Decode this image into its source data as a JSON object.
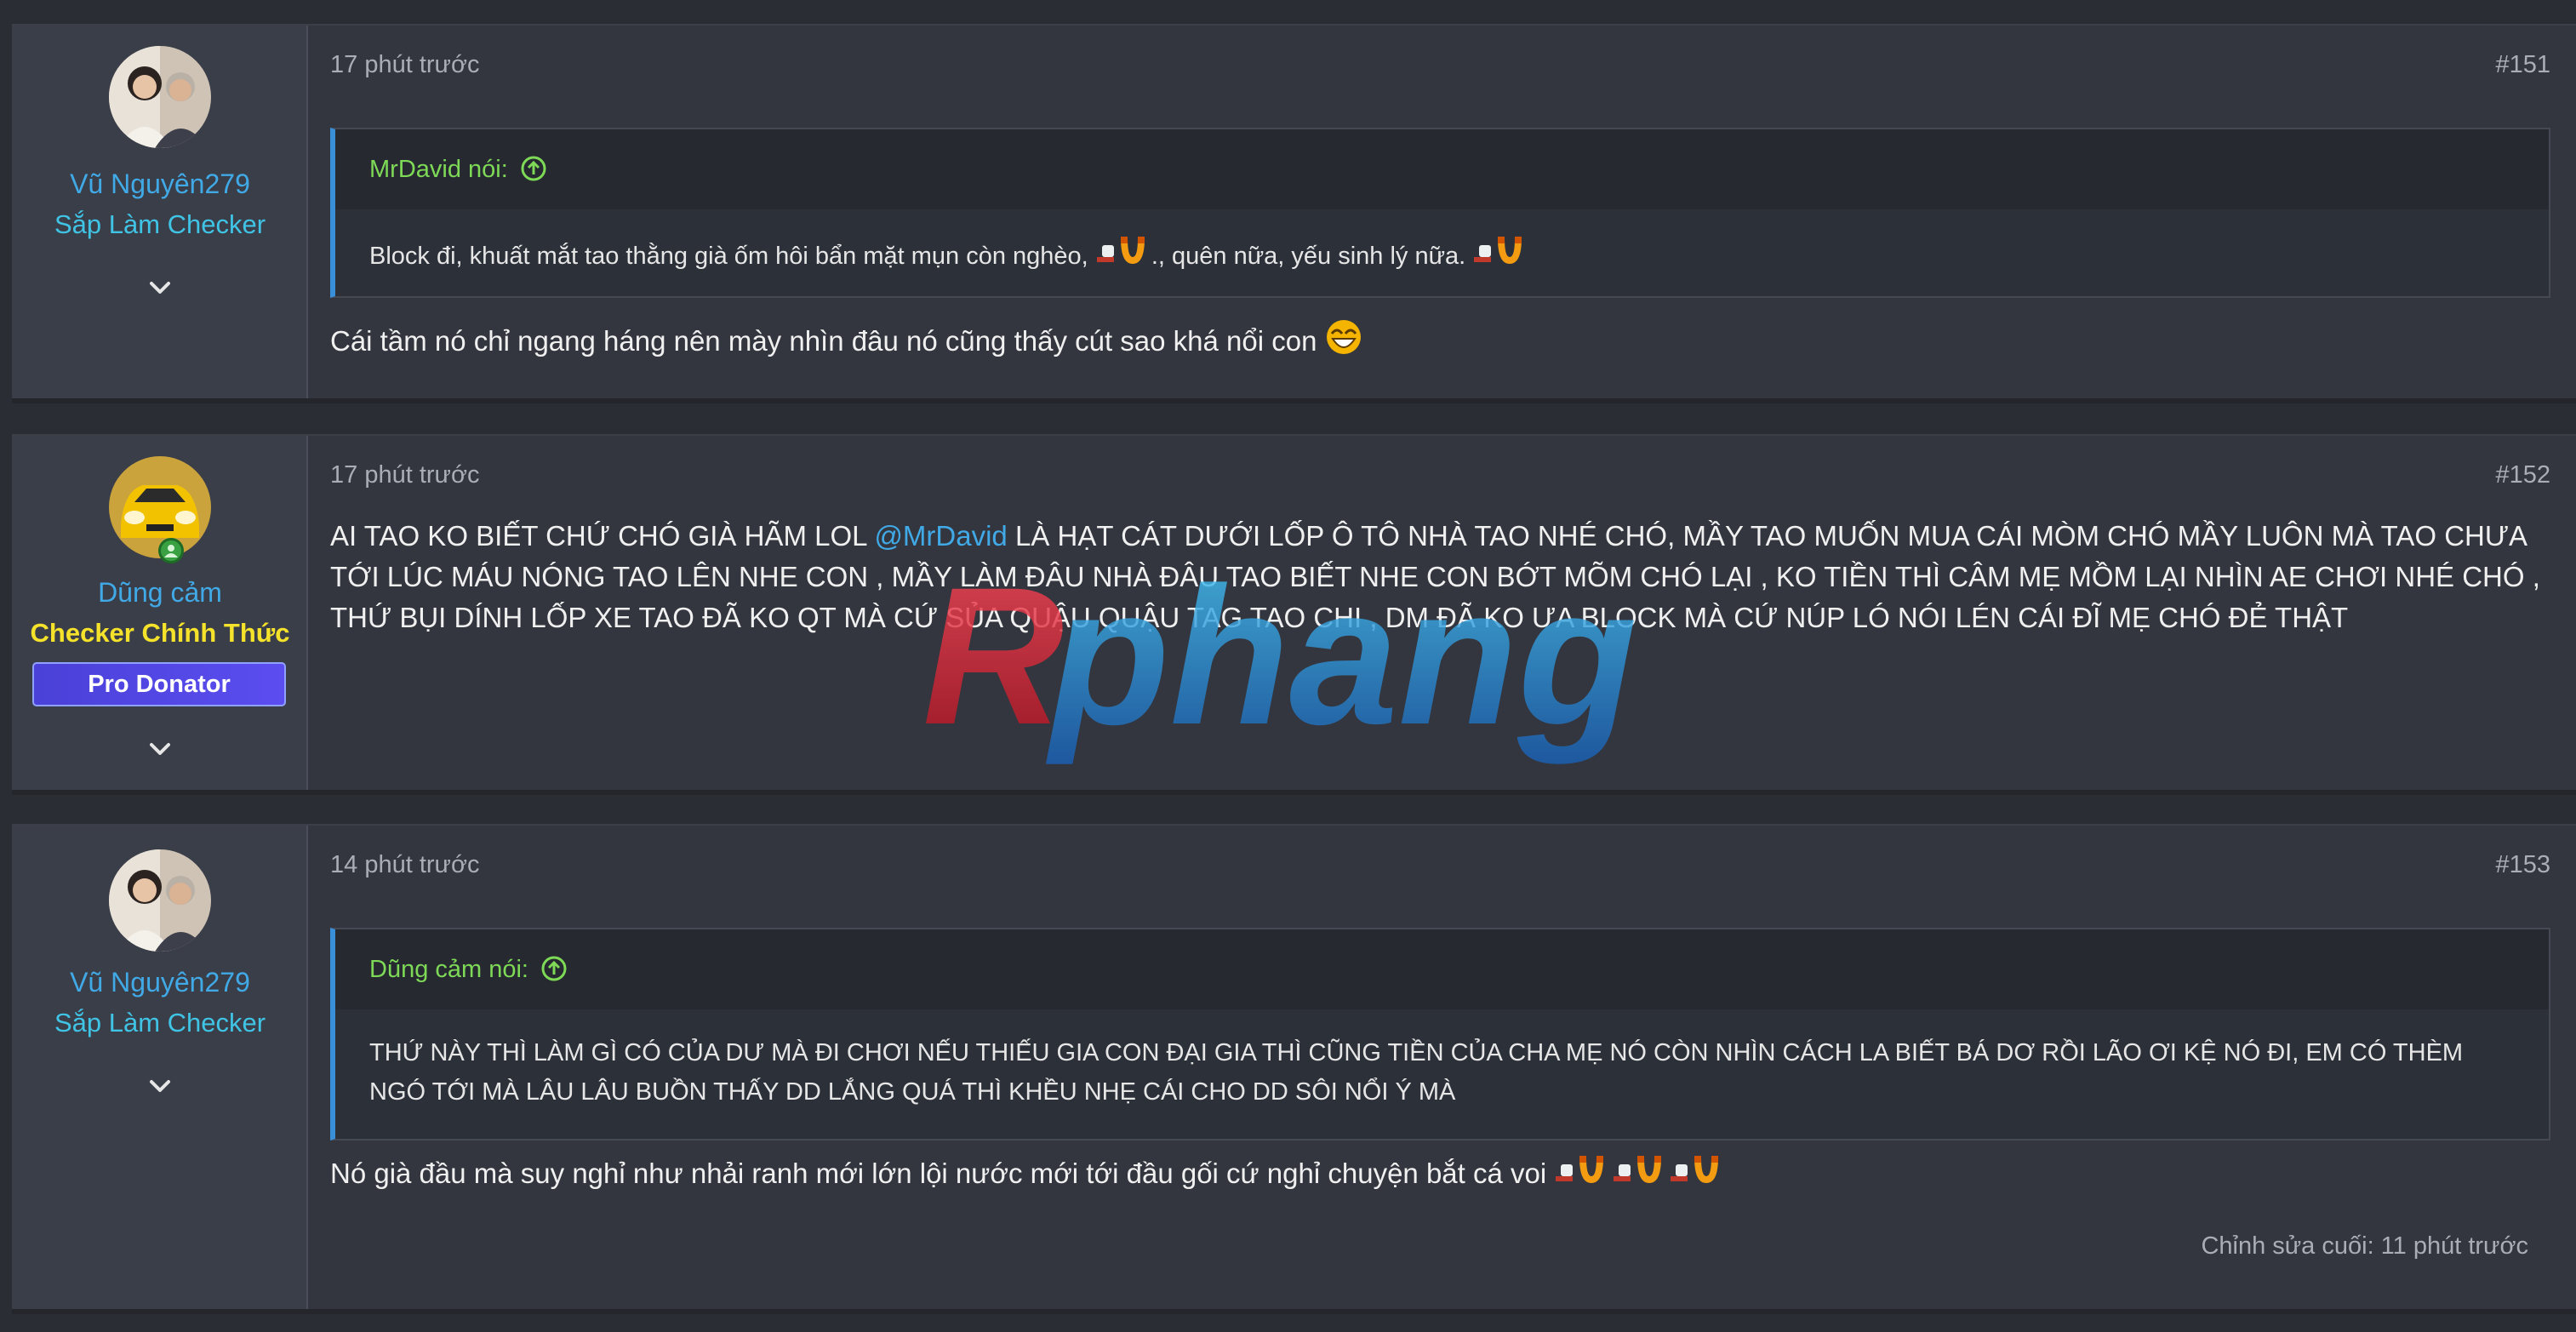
{
  "posts": [
    {
      "user": {
        "name": "Vũ Nguyên279",
        "title": "Sắp Làm Checker"
      },
      "time": "17 phút trước",
      "number": "#151",
      "quote": {
        "author": "MrDavid nói:",
        "text_a": "Block đi, khuất mắt tao thằng già ốm hôi bẩn mặt mụn còn nghèo,",
        "text_b": "., quên nữa, yếu sinh lý nữa."
      },
      "message": "Cái tầm nó chỉ ngang háng nên mày nhìn đâu nó cũng thấy cút sao khá nổi con"
    },
    {
      "user": {
        "name": "Dũng cảm",
        "title": "Checker Chính Thức",
        "badge": "Pro Donator"
      },
      "time": "17 phút trước",
      "number": "#152",
      "message_a": "AI TAO KO BIẾT CHỨ CHÓ GIÀ HÃM LOL ",
      "mention": "@MrDavid",
      "message_b": " LÀ HẠT CÁT DƯỚI LỐP Ô TÔ NHÀ TAO NHÉ CHÓ, MẦY TAO MUỐN MUA CÁI MÒM CHÓ MẦY LUÔN MÀ TAO CHƯA TỚI LÚC MÁU NÓNG TAO LÊN NHE CON , MẦY LÀM ĐÂU NHÀ ĐÂU TAO BIẾT NHE CON BỚT MÕM CHÓ LẠI , KO TIỀN THÌ CÂM MẸ MỒM LẠI NHÌN AE CHƠI NHÉ CHÓ , THỨ BỤI DÍNH LỐP XE TAO ĐÃ KO QT MÀ CỨ SỦA QUẬU QUẬU TAG TAO CHI , DM ĐÃ KO ƯA BLOCK MÀ CỨ NÚP LÓ NÓI LÉN CÁI ĐĨ MẸ CHÓ ĐẺ THẬT"
    },
    {
      "user": {
        "name": "Vũ Nguyên279",
        "title": "Sắp Làm Checker"
      },
      "time": "14 phút trước",
      "number": "#153",
      "quote": {
        "author": "Dũng cảm nói:",
        "text": "THỨ NÀY THÌ LÀM GÌ CÓ CỦA DƯ MÀ ĐI CHƠI NẾU THIẾU GIA CON ĐẠI GIA THÌ CŨNG TIỀN CỦA CHA MẸ NÓ CÒN NHÌN CÁCH LA BIẾT BÁ DƠ RỒI LÃO ƠI KỆ NÓ ĐI, EM CÓ THÈM NGÓ TỚI MÀ LÂU LÂU BUỒN THẤY DD LẮNG QUÁ THÌ KHỀU NHẸ CÁI CHO DD SÔI NỔI Ý MÀ"
      },
      "message": "Nó già đầu mà suy nghỉ như nhải ranh mới lớn lội nước mới tới đầu gối cứ nghỉ chuyện bắt cá voi",
      "edited": "Chỉnh sửa cuối: 11 phút trước"
    }
  ],
  "watermark": "Rphang",
  "colors": {
    "accent": "#40a9e6",
    "quote_author": "#7ed957",
    "gold_title": "#f5e22a",
    "badge": "#4a41d8"
  },
  "icons": [
    "chevron-down-icon",
    "arrow-up-circle-icon",
    "online-indicator-icon",
    "magnet-emoji-icon",
    "grin-emoji-icon"
  ]
}
